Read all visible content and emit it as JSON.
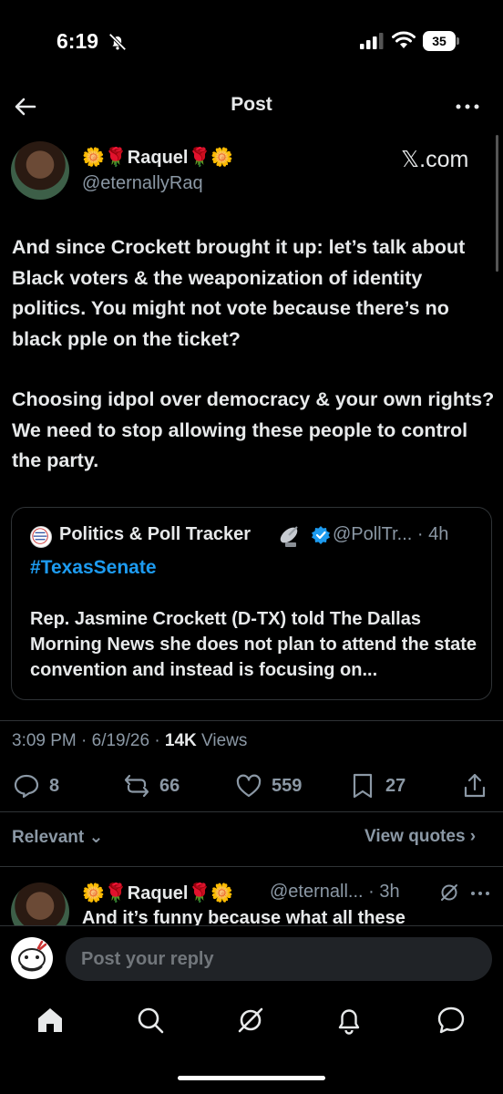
{
  "status_bar": {
    "time": "6:19",
    "battery": "35"
  },
  "header": {
    "title": "Post"
  },
  "post": {
    "author_name": "🌼🌹Raquel🌹🌼",
    "author_handle": "@eternallyRaq",
    "source": "𝕏.com",
    "paragraphs": [
      "And since Crockett brought it up: let’s talk about Black voters & the weaponization of identity politics. You might not vote because there’s no black pple on the ticket?",
      "Choosing idpol over democracy & your own rights? We need to stop allowing these people to control the party."
    ],
    "quote": {
      "name": "Politics & Poll Tracker",
      "handle": "@PollTr... · 4h",
      "hashtag": "#TexasSenate",
      "text": "Rep. Jasmine Crockett (D-TX) told The Dallas Morning News she does not plan to attend the state convention and instead is focusing on..."
    },
    "timestamp": "3:09 PM · 6/19/26 · ",
    "views_count": "14K",
    "views_label": " Views",
    "replies": "8",
    "reposts": "66",
    "likes": "559",
    "bookmarks": "27"
  },
  "filters": {
    "sort_label": "Relevant ⌄",
    "view_quotes": "View quotes ›"
  },
  "reply": {
    "author_name": "🌼🌹Raquel🌹🌼",
    "handle_time": "@eternall... · 3h",
    "text": "And it’s funny because what all these"
  },
  "composer": {
    "placeholder": "Post your reply"
  },
  "colors": {
    "accent": "#1d9bf0",
    "muted": "#8b98a5",
    "background": "#000000"
  }
}
